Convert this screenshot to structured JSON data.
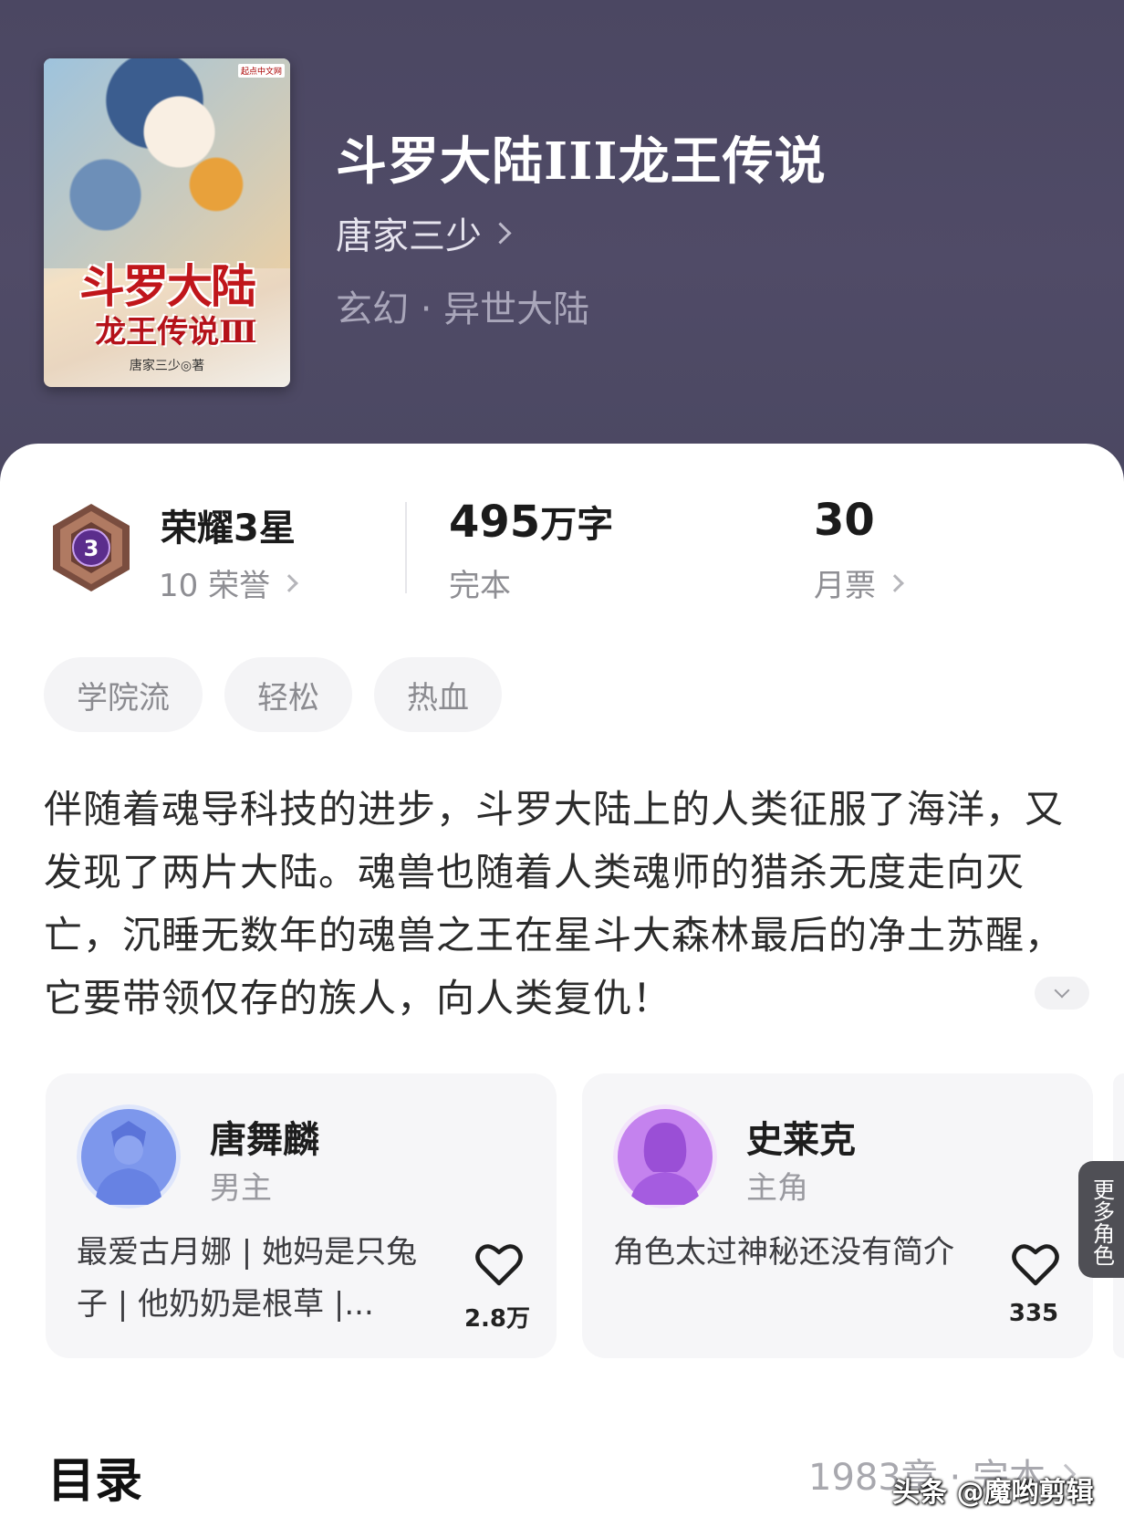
{
  "book": {
    "title": "斗罗大陆III龙王传说",
    "author": "唐家三少",
    "genre": "玄幻 · 异世大陆",
    "cover": {
      "main_title": "斗罗大陆",
      "sub_title": "龙王传说Ⅲ",
      "author_line": "唐家三少◎著",
      "publisher": "起点中文网"
    }
  },
  "stats": {
    "honor": {
      "title": "荣耀3星",
      "badge_number": "3",
      "sub": "10 荣誉"
    },
    "words": {
      "value": "495",
      "unit": "万字",
      "sub": "完本"
    },
    "tickets": {
      "value": "30",
      "sub": "月票"
    }
  },
  "tags": [
    "学院流",
    "轻松",
    "热血"
  ],
  "description": "伴随着魂导科技的进步，斗罗大陆上的人类征服了海洋，又发现了两片大陆。魂兽也随着人类魂师的猎杀无度走向灭亡，沉睡无数年的魂兽之王在星斗大森林最后的净土苏醒，它要带领仅存的族人，向人类复仇！",
  "roles": [
    {
      "name": "唐舞麟",
      "role": "男主",
      "desc": "最爱古月娜 | 她妈是只兔子 | 他奶奶是根草 |...",
      "likes": "2.8万"
    },
    {
      "name": "史莱克",
      "role": "主角",
      "desc": "角色太过神秘还没有简介",
      "likes": "335"
    }
  ],
  "more_roles_label": "更多角色",
  "toc": {
    "title": "目录",
    "meta": "1983章 · 完本"
  },
  "watermark": "头条 @魔哟剪辑",
  "colors": {
    "hero_bg": "#4b4762",
    "card_bg": "#ffffff",
    "badge_purple": "#5b2d8c",
    "badge_bronze": "#8a5a4a",
    "avatar_blue": "#6f8ee8",
    "avatar_purple": "#b46ee6"
  }
}
